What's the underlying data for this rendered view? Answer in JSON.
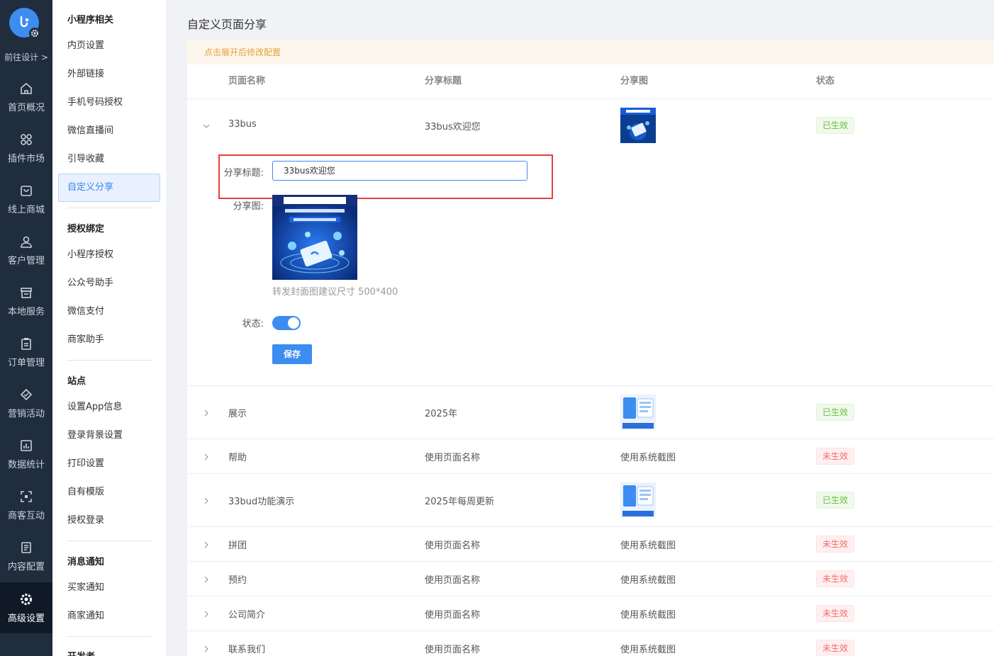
{
  "rail": {
    "goto_label": "前往设计 >",
    "items": [
      {
        "label": "首页概况",
        "icon": "home-icon"
      },
      {
        "label": "插件市场",
        "icon": "plugin-icon"
      },
      {
        "label": "线上商城",
        "icon": "shop-icon"
      },
      {
        "label": "客户管理",
        "icon": "user-icon"
      },
      {
        "label": "本地服务",
        "icon": "store-icon"
      },
      {
        "label": "订单管理",
        "icon": "order-icon"
      },
      {
        "label": "营销活动",
        "icon": "marketing-icon"
      },
      {
        "label": "数据统计",
        "icon": "chart-icon"
      },
      {
        "label": "商客互动",
        "icon": "scan-icon"
      },
      {
        "label": "内容配置",
        "icon": "document-icon"
      },
      {
        "label": "高级设置",
        "icon": "gear-icon"
      }
    ]
  },
  "submenu": {
    "groups": [
      {
        "title": "小程序相关",
        "items": [
          "内页设置",
          "外部链接",
          "手机号码授权",
          "微信直播间",
          "引导收藏",
          "自定义分享"
        ]
      },
      {
        "title": "授权绑定",
        "items": [
          "小程序授权",
          "公众号助手",
          "微信支付",
          "商家助手"
        ]
      },
      {
        "title": "站点",
        "items": [
          "设置App信息",
          "登录背景设置",
          "打印设置",
          "自有模版",
          "授权登录"
        ]
      },
      {
        "title": "消息通知",
        "items": [
          "买家通知",
          "商家通知"
        ]
      },
      {
        "title": "开发者",
        "items": []
      }
    ]
  },
  "page": {
    "title": "自定义页面分享",
    "notice": "点击展开后修改配置"
  },
  "table": {
    "headers": [
      "页面名称",
      "分享标题",
      "分享图",
      "状态"
    ],
    "rows": [
      {
        "name": "33bus",
        "title": "33bus欢迎您",
        "image": "thumb",
        "status": "已生效",
        "on": true
      },
      {
        "name": "展示",
        "title": "2025年",
        "image": "thumb2",
        "status": "已生效",
        "on": true
      },
      {
        "name": "帮助",
        "title": "使用页面名称",
        "image": "使用系统截图",
        "status": "未生效",
        "on": false
      },
      {
        "name": "33bud功能演示",
        "title": "2025年每周更新",
        "image": "thumb2",
        "status": "已生效",
        "on": true
      },
      {
        "name": "拼团",
        "title": "使用页面名称",
        "image": "使用系统截图",
        "status": "未生效",
        "on": false
      },
      {
        "name": "预约",
        "title": "使用页面名称",
        "image": "使用系统截图",
        "status": "未生效",
        "on": false
      },
      {
        "name": "公司简介",
        "title": "使用页面名称",
        "image": "使用系统截图",
        "status": "未生效",
        "on": false
      },
      {
        "name": "联系我们",
        "title": "使用页面名称",
        "image": "使用系统截图",
        "status": "未生效",
        "on": false
      }
    ]
  },
  "edit": {
    "title_label": "分享标题:",
    "title_value": "33bus欢迎您",
    "image_label": "分享图:",
    "image_hint": "转发封面图建议尺寸 500*400",
    "status_label": "状态:",
    "status_on": true,
    "save_label": "保存"
  },
  "colors": {
    "accent": "#3d8cf0",
    "sidebar_bg": "#1f2d3d",
    "success": "#67c23a",
    "danger": "#f56c6c",
    "highlight_border": "#e53e3e"
  }
}
